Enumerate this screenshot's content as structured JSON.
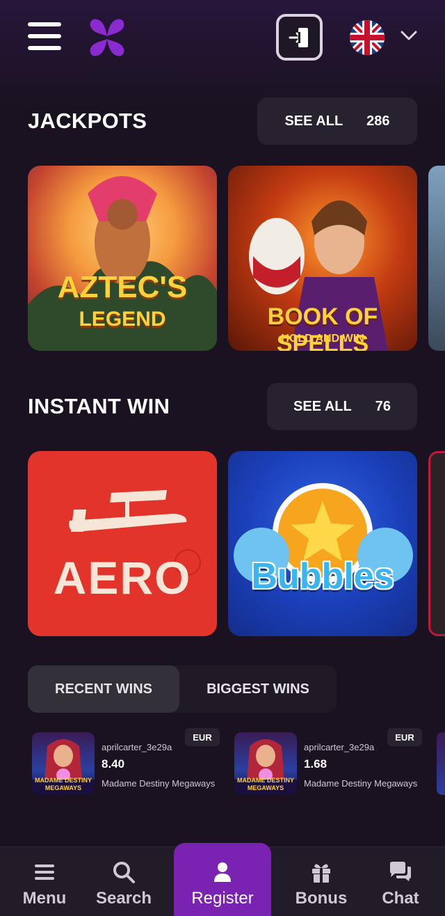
{
  "header": {
    "menu_icon": "hamburger-icon",
    "logo_icon": "flower-logo-icon",
    "login_icon": "login-door-icon",
    "language_flag": "uk-flag-icon",
    "language_chevron": "chevron-down-icon"
  },
  "sections": {
    "jackpots": {
      "title": "JACKPOTS",
      "see_all_label": "SEE ALL",
      "count": "286",
      "games": [
        {
          "name_line1": "AZTEC'S",
          "name_line2": "LEGEND"
        },
        {
          "name_line1": "BOOK OF SPELLS",
          "name_line2": "HOLD AND WIN"
        }
      ]
    },
    "instant_win": {
      "title": "INSTANT WIN",
      "see_all_label": "SEE ALL",
      "count": "76",
      "games": [
        {
          "name": "AERO"
        },
        {
          "name": "Bubbles"
        }
      ]
    }
  },
  "wins": {
    "tabs": [
      "RECENT WINS",
      "BIGGEST WINS"
    ],
    "active_tab": "RECENT WINS",
    "items": [
      {
        "user": "aprilcarter_3e29a",
        "amount": "8.40",
        "game": "Madame Destiny Megaways",
        "currency": "EUR",
        "thumb_title": "MADAME DESTINY MEGAWAYS"
      },
      {
        "user": "aprilcarter_3e29a",
        "amount": "1.68",
        "game": "Madame Destiny Megaways",
        "currency": "EUR",
        "thumb_title": "MADAME DESTINY MEGAWAYS"
      }
    ]
  },
  "bottom_nav": {
    "items": [
      {
        "label": "Menu",
        "icon": "menu-icon"
      },
      {
        "label": "Search",
        "icon": "search-icon"
      },
      {
        "label": "Register",
        "icon": "user-icon"
      },
      {
        "label": "Bonus",
        "icon": "gift-icon"
      },
      {
        "label": "Chat",
        "icon": "chat-icon"
      }
    ]
  },
  "colors": {
    "background": "#1a1220",
    "accent": "#7a23b3",
    "button_bg": "#272130",
    "nav_bg": "#221b28"
  }
}
